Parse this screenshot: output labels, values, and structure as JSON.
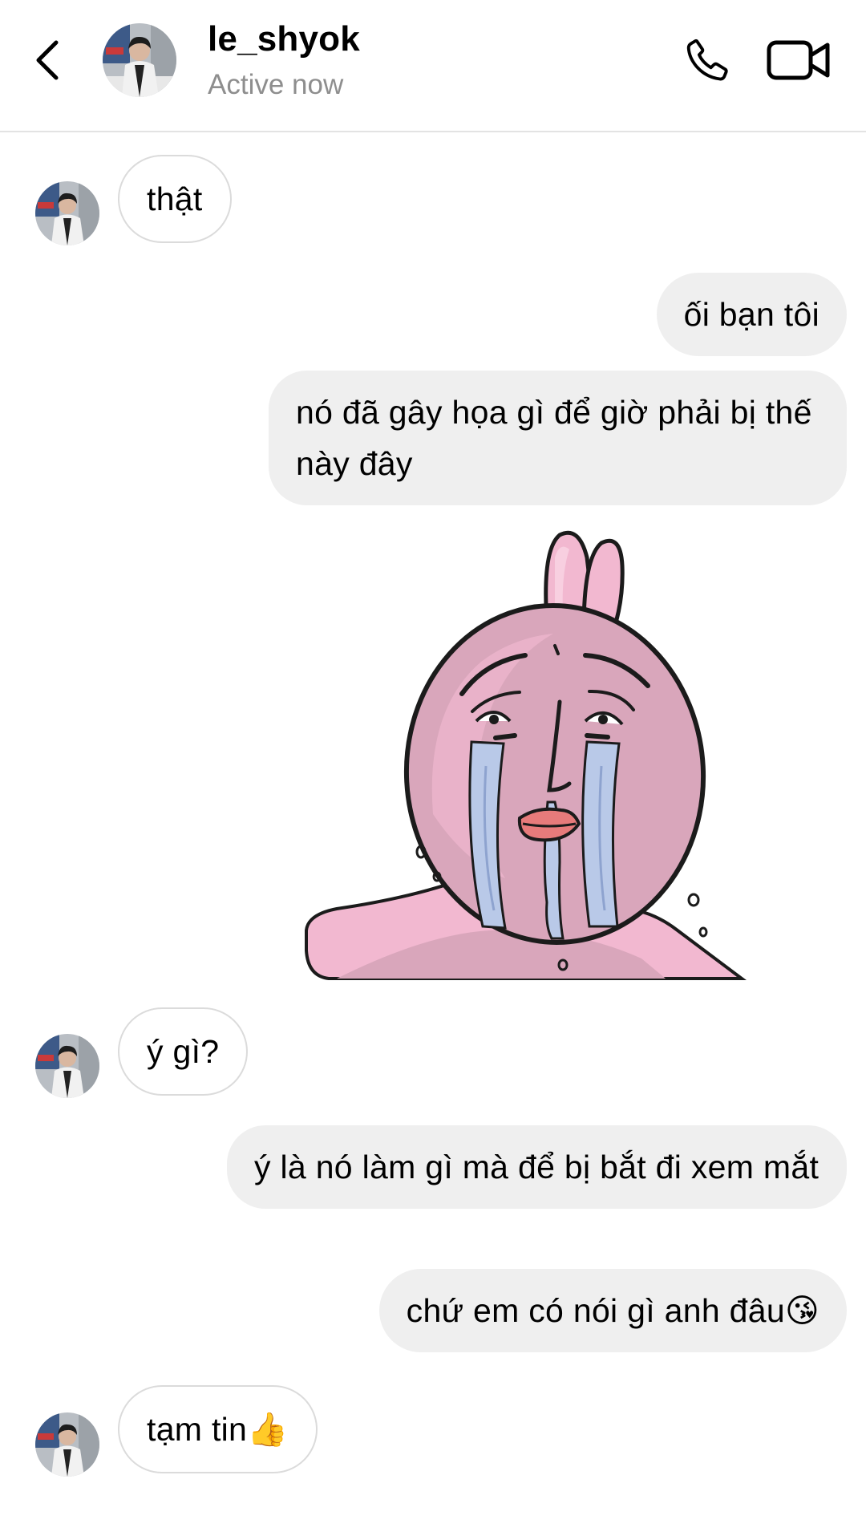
{
  "header": {
    "contact_name": "le_shyok",
    "status": "Active now",
    "icons": {
      "back": "chevron-left-icon",
      "call": "phone-icon",
      "video": "video-camera-icon"
    }
  },
  "messages": [
    {
      "sender": "contact",
      "text": "thật"
    },
    {
      "sender": "me",
      "text": "ối bạn tôi"
    },
    {
      "sender": "me",
      "text": "nó đã gây họa gì để giờ phải bị thế này đây"
    },
    {
      "sender": "me",
      "type": "sticker",
      "sticker": "crying-pink-rabbit"
    },
    {
      "sender": "contact",
      "text": "ý gì?"
    },
    {
      "sender": "me",
      "text": "ý là nó làm gì mà để bị bắt đi xem mắt"
    },
    {
      "sender": "me",
      "text": "chứ em có nói gì anh đâu😘"
    },
    {
      "sender": "contact",
      "text": "tạm tin👍"
    }
  ],
  "colors": {
    "outgoing_bubble": "#efefef",
    "incoming_border": "#dbdbdb",
    "status_text": "#8e8e8e",
    "sticker_pink": "#f2b6cf"
  }
}
